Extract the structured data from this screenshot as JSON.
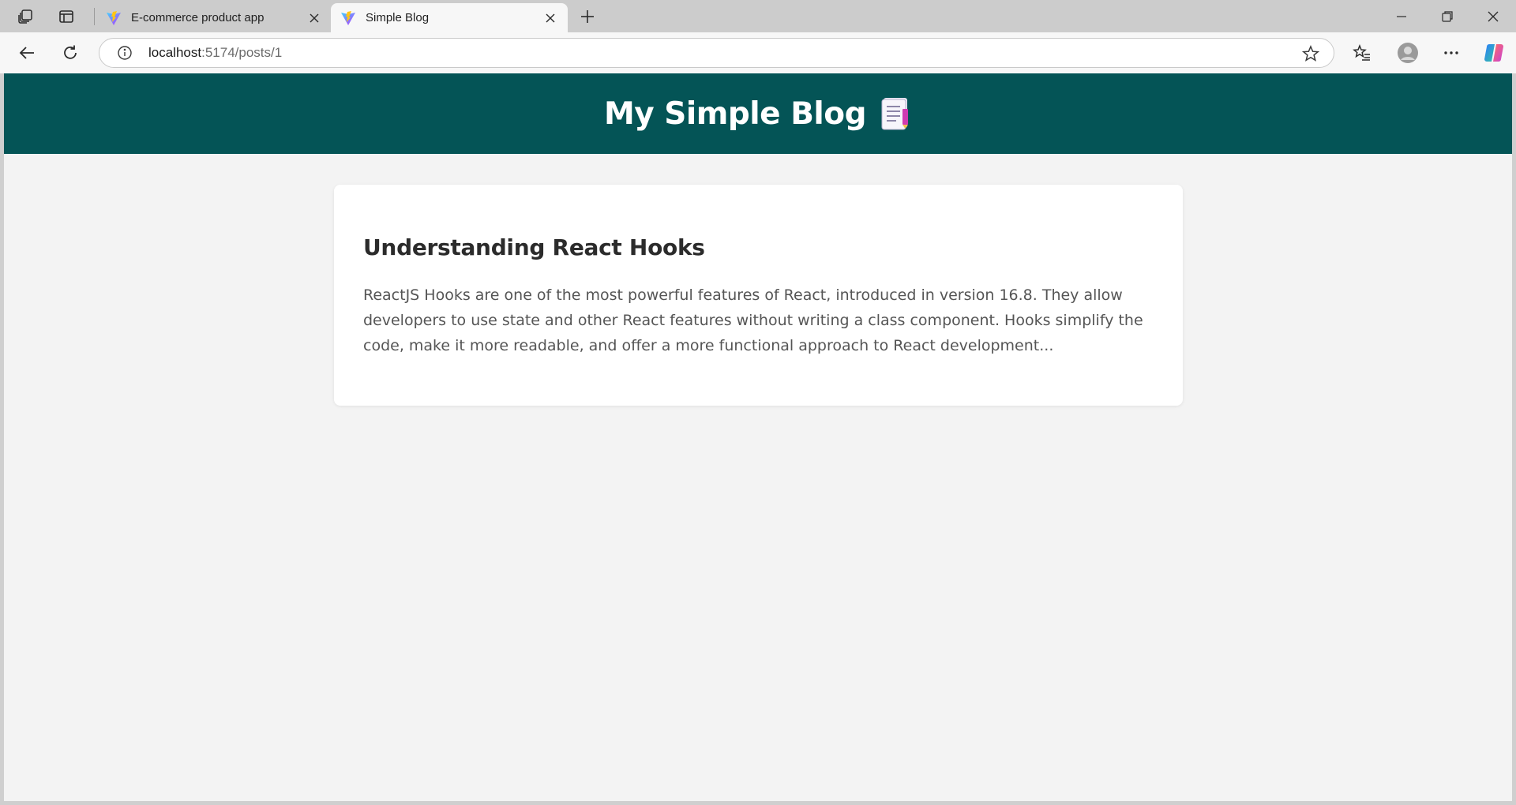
{
  "browser": {
    "tabs": [
      {
        "title": "E-commerce product app",
        "active": false
      },
      {
        "title": "Simple Blog",
        "active": true
      }
    ],
    "address": {
      "host": "localhost",
      "path": ":5174/posts/1"
    },
    "accent": "#045456"
  },
  "site": {
    "title": "My Simple Blog"
  },
  "post": {
    "title": "Understanding React Hooks",
    "excerpt": "ReactJS Hooks are one of the most powerful features of React, introduced in version 16.8. They allow developers to use state and other React features without writing a class component. Hooks simplify the code, make it more readable, and offer a more functional approach to React development..."
  }
}
